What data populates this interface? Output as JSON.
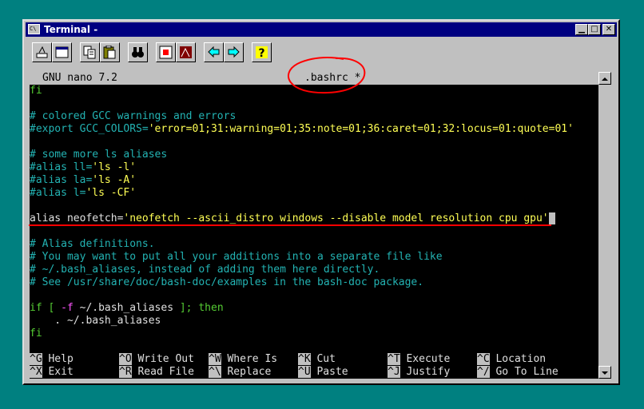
{
  "window": {
    "title": "Terminal -",
    "icon": "ms-dos-icon",
    "icon_text": "C\\",
    "controls": {
      "minimize": "▁",
      "maximize": "□",
      "close": "✕"
    }
  },
  "toolbar": {
    "buttons": [
      "mark-icon",
      "fullscreen-icon",
      "copy-icon",
      "paste-icon",
      "find-icon",
      "properties-icon",
      "background-icon",
      "back-icon",
      "forward-icon",
      "help-icon"
    ]
  },
  "nano": {
    "version": "GNU nano 7.2",
    "filename": ".bashrc *"
  },
  "editor_lines": [
    {
      "spans": [
        {
          "t": "fi",
          "c": "grn"
        }
      ]
    },
    {
      "spans": []
    },
    {
      "spans": [
        {
          "t": "# colored GCC warnings and errors",
          "c": "com"
        }
      ]
    },
    {
      "spans": [
        {
          "t": "#export GCC_COLORS=",
          "c": "com"
        },
        {
          "t": "'error=01;31:warning=01;35:note=01;36:caret=01;32:locus=01:quote=01'",
          "c": "yel"
        }
      ]
    },
    {
      "spans": []
    },
    {
      "spans": [
        {
          "t": "# some more ls aliases",
          "c": "com"
        }
      ]
    },
    {
      "spans": [
        {
          "t": "#alias ll=",
          "c": "com"
        },
        {
          "t": "'ls -l'",
          "c": "yel"
        }
      ]
    },
    {
      "spans": [
        {
          "t": "#alias la=",
          "c": "com"
        },
        {
          "t": "'ls -A'",
          "c": "yel"
        }
      ]
    },
    {
      "spans": [
        {
          "t": "#alias l=",
          "c": "com"
        },
        {
          "t": "'ls -CF'",
          "c": "yel"
        }
      ]
    },
    {
      "spans": []
    },
    {
      "spans": [
        {
          "t": "alias neofetch=",
          "c": "wht"
        },
        {
          "t": "'neofetch --ascii_distro windows --disable model resolution cpu gpu'",
          "c": "yel"
        }
      ],
      "cursor": true
    },
    {
      "spans": []
    },
    {
      "spans": [
        {
          "t": "# Alias definitions.",
          "c": "com"
        }
      ]
    },
    {
      "spans": [
        {
          "t": "# You may want to put all your additions into a separate file like",
          "c": "com"
        }
      ]
    },
    {
      "spans": [
        {
          "t": "# ~/.bash_aliases, instead of adding them here directly.",
          "c": "com"
        }
      ]
    },
    {
      "spans": [
        {
          "t": "# See /usr/share/doc/bash-doc/examples in the bash-doc package.",
          "c": "com"
        }
      ]
    },
    {
      "spans": []
    },
    {
      "spans": [
        {
          "t": "if [ ",
          "c": "grn"
        },
        {
          "t": "-f",
          "c": "mag"
        },
        {
          "t": " ",
          "c": "grn"
        },
        {
          "t": "~/.bash_aliases",
          "c": "wht"
        },
        {
          "t": " ]; then",
          "c": "grn"
        }
      ]
    },
    {
      "spans": [
        {
          "t": "    . ~/.bash_aliases",
          "c": "wht"
        }
      ]
    },
    {
      "spans": [
        {
          "t": "fi",
          "c": "grn"
        }
      ]
    }
  ],
  "shortcuts_row1": [
    {
      "key": "^G",
      "label": "Help"
    },
    {
      "key": "^O",
      "label": "Write Out"
    },
    {
      "key": "^W",
      "label": "Where Is"
    },
    {
      "key": "^K",
      "label": "Cut"
    },
    {
      "key": "^T",
      "label": "Execute"
    },
    {
      "key": "^C",
      "label": "Location"
    }
  ],
  "shortcuts_row2": [
    {
      "key": "^X",
      "label": "Exit"
    },
    {
      "key": "^R",
      "label": "Read File"
    },
    {
      "key": "^\\",
      "label": "Replace"
    },
    {
      "key": "^U",
      "label": "Paste"
    },
    {
      "key": "^J",
      "label": "Justify"
    },
    {
      "key": "^/",
      "label": "Go To Line"
    }
  ],
  "annotation_colors": {
    "ink": "#ff0000"
  }
}
